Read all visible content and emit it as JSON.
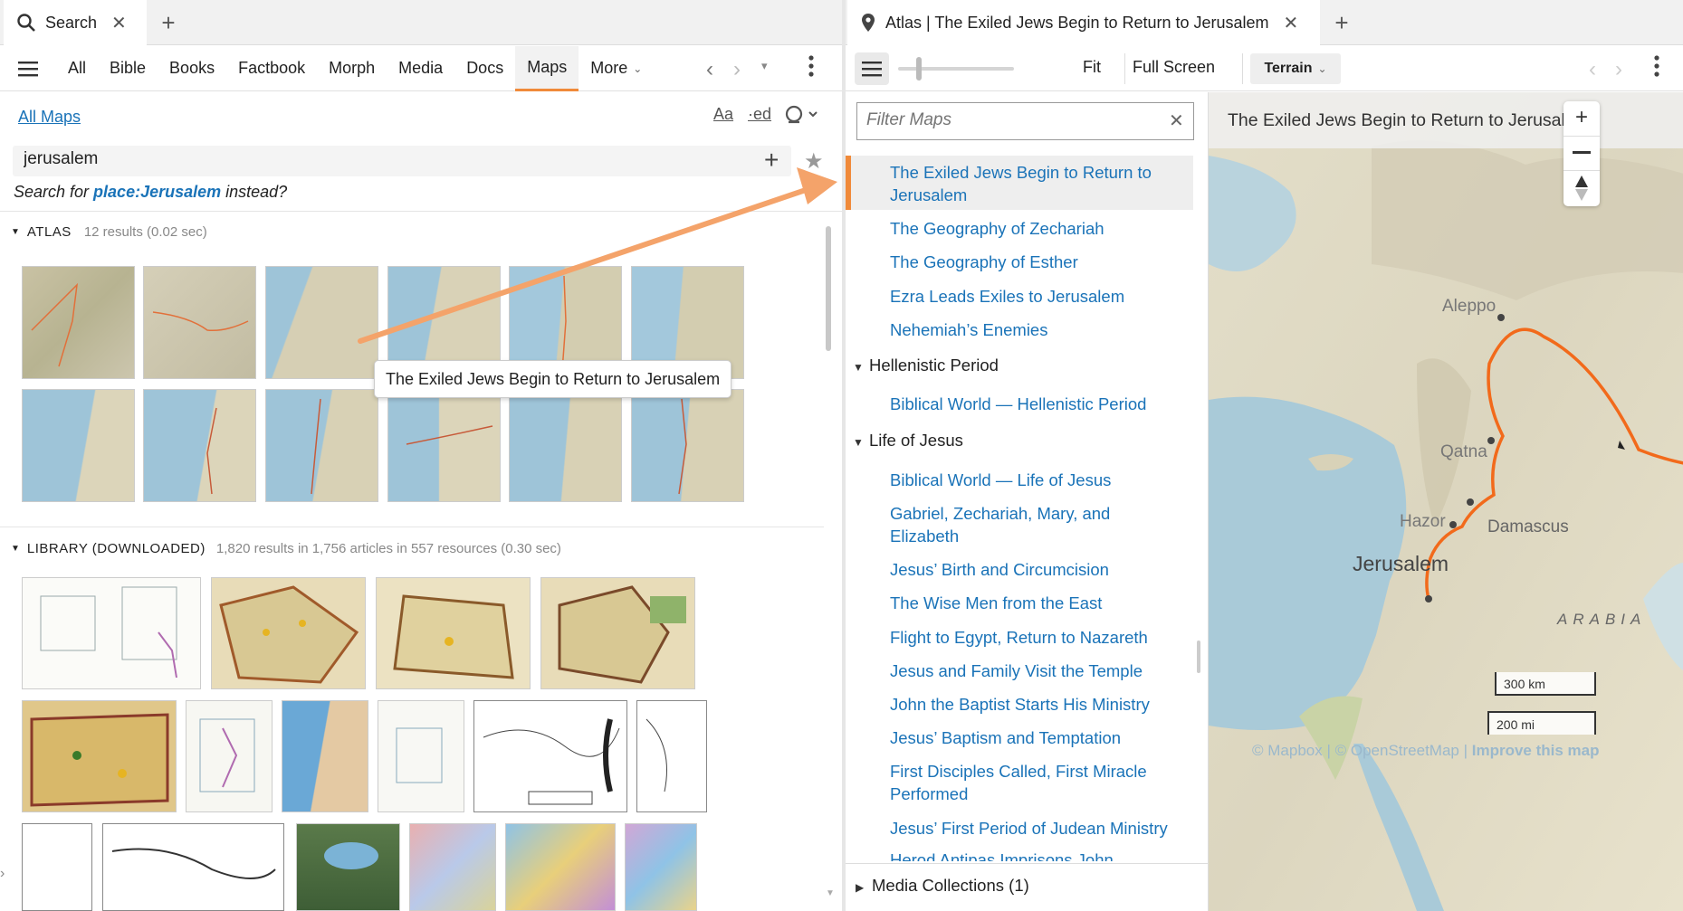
{
  "left_tab": {
    "label": "Search",
    "close": "✕"
  },
  "right_tab": {
    "label": "Atlas | The Exiled Jews Begin to Return to Jerusalem",
    "close": "✕"
  },
  "left_toolbar": {
    "items": [
      "All",
      "Bible",
      "Books",
      "Factbook",
      "Morph",
      "Media",
      "Docs",
      "Maps",
      "More"
    ],
    "active": "Maps"
  },
  "search": {
    "all_maps": "All Maps",
    "query": "jerusalem",
    "suggest_prefix": "Search for ",
    "suggest_link": "place:Jerusalem",
    "suggest_suffix": " instead?",
    "aa": "Aa",
    "ed": "·ed"
  },
  "atlas_section": {
    "label": "ATLAS",
    "meta": "12 results (0.02 sec)"
  },
  "library_section": {
    "label": "LIBRARY (DOWNLOADED)",
    "meta": "1,820 results in 1,756 articles in 557 resources (0.30 sec)"
  },
  "tooltip": "The Exiled Jews Begin to Return to Jerusalem",
  "right_toolbar": {
    "fit": "Fit",
    "full_screen": "Full Screen",
    "terrain": "Terrain"
  },
  "filter": {
    "placeholder": "Filter Maps"
  },
  "map_list": {
    "selected": "The Exiled Jews Begin to Return to Jerusalem",
    "items_a": [
      "The Geography of Zechariah",
      "The Geography of Esther",
      "Ezra Leads Exiles to Jerusalem",
      "Nehemiah’s Enemies"
    ],
    "group_hellenistic": "Hellenistic Period",
    "items_b": [
      "Biblical World — Hellenistic Period"
    ],
    "group_jesus": "Life of Jesus",
    "items_c": [
      "Biblical World — Life of Jesus",
      "Gabriel, Zechariah, Mary, and Elizabeth",
      "Jesus’ Birth and Circumcision",
      "The Wise Men from the East",
      "Flight to Egypt, Return to Nazareth",
      "Jesus and Family Visit the Temple",
      "John the Baptist Starts His Ministry",
      "Jesus’ Baptism and Temptation",
      "First Disciples Called, First Miracle Performed",
      "Jesus’ First Period of Judean Ministry",
      "Herod Antipas Imprisons John"
    ],
    "media_collections": "Media Collections (1)"
  },
  "map": {
    "title": "The Exiled Jews Begin to Return to Jerusalem",
    "labels": {
      "aleppo": "Aleppo",
      "qatna": "Qatna",
      "hazor": "Hazor",
      "damascus": "Damascus",
      "jerusalem": "Jerusalem",
      "arabia": "ARABIA"
    },
    "scale_km": "300 km",
    "scale_mi": "200 mi",
    "attribution_mapbox": "© Mapbox",
    "attribution_sep": " | ",
    "attribution_osm": "© OpenStreetMap",
    "attribution_improve": "Improve this map"
  },
  "colors": {
    "accent": "#f08a3a",
    "link": "#1a73b8",
    "route": "#f26a1b"
  }
}
